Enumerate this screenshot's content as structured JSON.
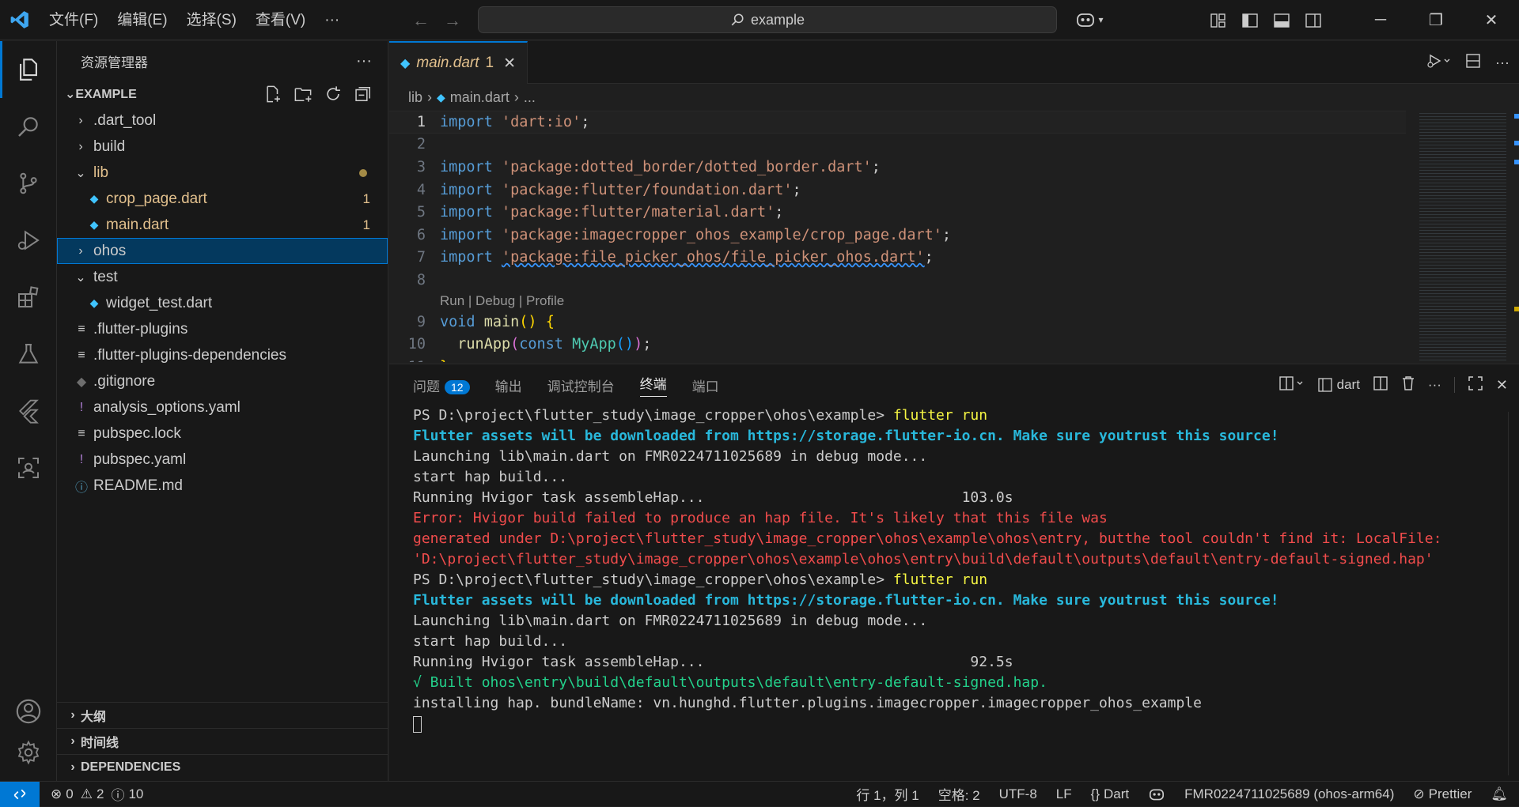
{
  "menu": {
    "items": [
      "文件(F)",
      "编辑(E)",
      "选择(S)",
      "查看(V)"
    ],
    "more": "···"
  },
  "search": {
    "text": "example"
  },
  "sidebar": {
    "title": "资源管理器",
    "more": "···",
    "root": "EXAMPLE",
    "tree": [
      {
        "label": ".dart_tool",
        "type": "folder",
        "open": false
      },
      {
        "label": "build",
        "type": "folder",
        "open": false
      },
      {
        "label": "lib",
        "type": "folder",
        "open": true,
        "modified": true
      },
      {
        "label": "crop_page.dart",
        "type": "dart",
        "badge": "1",
        "modified": true
      },
      {
        "label": "main.dart",
        "type": "dart",
        "badge": "1",
        "modified": true
      },
      {
        "label": "ohos",
        "type": "folder",
        "open": false,
        "selected": true
      },
      {
        "label": "test",
        "type": "folder",
        "open": true
      },
      {
        "label": "widget_test.dart",
        "type": "dart"
      },
      {
        "label": ".flutter-plugins",
        "type": "lines"
      },
      {
        "label": ".flutter-plugins-dependencies",
        "type": "lines"
      },
      {
        "label": ".gitignore",
        "type": "git"
      },
      {
        "label": "analysis_options.yaml",
        "type": "yaml"
      },
      {
        "label": "pubspec.lock",
        "type": "lines"
      },
      {
        "label": "pubspec.yaml",
        "type": "yaml"
      },
      {
        "label": "README.md",
        "type": "info"
      }
    ],
    "outline": "大纲",
    "timeline": "时间线",
    "dependencies": "DEPENDENCIES"
  },
  "editor": {
    "tab": {
      "label": "main.dart",
      "badge": "1"
    },
    "breadcrumb": [
      "lib",
      "main.dart",
      "..."
    ],
    "codelens": "Run | Debug | Profile"
  },
  "panel": {
    "tabs": [
      {
        "label": "问题",
        "badge": "12"
      },
      {
        "label": "输出"
      },
      {
        "label": "调试控制台"
      },
      {
        "label": "终端",
        "active": true
      },
      {
        "label": "端口"
      }
    ],
    "shell": "dart",
    "terminal": [
      {
        "prompt": "PS D:\\project\\flutter_study\\image_cropper\\ohos\\example> ",
        "cmd": "flutter run"
      },
      {
        "cls": "t-cyan",
        "text": "Flutter assets will be downloaded from https://storage.flutter-io.cn. Make sure youtrust this source!"
      },
      {
        "cls": "t-def",
        "text": "Launching lib\\main.dart on FMR0224711025689 in debug mode..."
      },
      {
        "cls": "t-def",
        "text": "start hap build..."
      },
      {
        "cls": "t-def",
        "text": "Running Hvigor task assembleHap...                              103.0s"
      },
      {
        "cls": "t-red",
        "text": "Error: Hvigor build failed to produce an hap file. It's likely that this file was"
      },
      {
        "cls": "t-red",
        "text": "generated under D:\\project\\flutter_study\\image_cropper\\ohos\\example\\ohos\\entry, butthe tool couldn't find it: LocalFile:"
      },
      {
        "cls": "t-red",
        "text": "'D:\\project\\flutter_study\\image_cropper\\ohos\\example\\ohos\\entry\\build\\default\\outputs\\default\\entry-default-signed.hap'"
      },
      {
        "prompt": "PS D:\\project\\flutter_study\\image_cropper\\ohos\\example> ",
        "cmd": "flutter run"
      },
      {
        "cls": "t-cyan",
        "text": "Flutter assets will be downloaded from https://storage.flutter-io.cn. Make sure youtrust this source!"
      },
      {
        "cls": "t-def",
        "text": "Launching lib\\main.dart on FMR0224711025689 in debug mode..."
      },
      {
        "cls": "t-def",
        "text": "start hap build..."
      },
      {
        "cls": "t-def",
        "text": "Running Hvigor task assembleHap...                               92.5s"
      },
      {
        "cls": "t-green",
        "text": "√ Built ohos\\entry\\build\\default\\outputs\\default\\entry-default-signed.hap."
      },
      {
        "cls": "t-def",
        "text": "installing hap. bundleName: vn.hunghd.flutter.plugins.imagecropper.imagecropper_ohos_example"
      }
    ]
  },
  "status": {
    "errors": "0",
    "warnings": "2",
    "infos": "10",
    "position": "行 1，列 1",
    "spaces": "空格: 2",
    "encoding": "UTF-8",
    "eol": "LF",
    "language": "Dart",
    "device": "FMR0224711025689 (ohos-arm64)",
    "formatter": "Prettier"
  },
  "colors": {
    "accent": "#0078d4",
    "modified": "#e2c08d",
    "error": "#f14c4c",
    "ok": "#23d18b"
  }
}
